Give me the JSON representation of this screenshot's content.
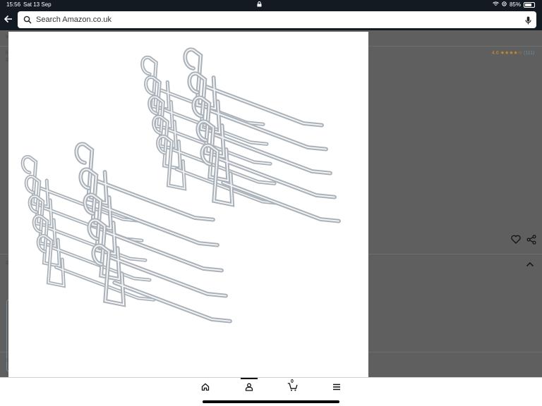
{
  "status_bar": {
    "time": "15:56",
    "date": "Sat 13 Sep",
    "battery": "85%",
    "battery_level": 0.85
  },
  "search": {
    "placeholder": "Search Amazon.co.uk"
  },
  "product": {
    "rating_value": "4.6",
    "rating_stars": "★★★★☆",
    "rating_count": "(111)"
  },
  "bottom_nav": {
    "cart_count": "0"
  },
  "colors": {
    "topbar": "#141a22",
    "overlay": "#5f5f5f",
    "modal": "#ffffff",
    "star": "#d08a2a"
  }
}
